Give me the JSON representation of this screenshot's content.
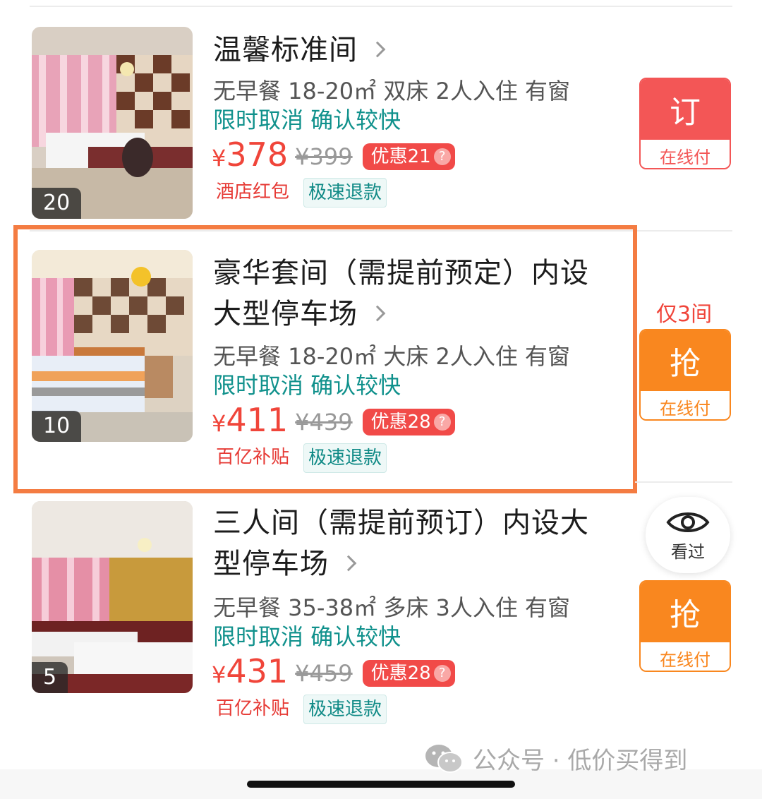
{
  "rooms": [
    {
      "title": "温馨标准间",
      "photo_count": "20",
      "meta": "无早餐 18-20㎡ 双床 2人入住 有窗",
      "policy": "限时取消 确认较快",
      "price_symbol": "¥",
      "price": "378",
      "original_price": "¥399",
      "discount": "优惠21",
      "tags": [
        "酒店红包",
        "极速退款"
      ],
      "availability": "",
      "button_main": "订",
      "button_sub": "在线付",
      "button_color": "#f35656"
    },
    {
      "title": "豪华套间（需提前预定）内设大型停车场",
      "photo_count": "10",
      "meta": "无早餐 18-20㎡ 大床 2人入住 有窗",
      "policy": "限时取消 确认较快",
      "price_symbol": "¥",
      "price": "411",
      "original_price": "¥439",
      "discount": "优惠28",
      "tags": [
        "百亿补贴",
        "极速退款"
      ],
      "availability": "仅3间",
      "button_main": "抢",
      "button_sub": "在线付",
      "button_color": "#f9871f"
    },
    {
      "title": "三人间（需提前预订）内设大型停车场",
      "photo_count": "5",
      "meta": "无早餐 35-38㎡ 多床 3人入住 有窗",
      "policy": "限时取消 确认较快",
      "price_symbol": "¥",
      "price": "431",
      "original_price": "¥459",
      "discount": "优惠28",
      "tags": [
        "百亿补贴",
        "极速退款"
      ],
      "availability": "",
      "button_main": "抢",
      "button_sub": "在线付",
      "button_color": "#f9871f"
    }
  ],
  "discount_help": "?",
  "viewed_button": {
    "label": "看过",
    "icon": "eye-icon"
  },
  "watermark": {
    "icon": "wechat-icon",
    "text": "公众号 · 低价买得到"
  },
  "colors": {
    "price_red": "#f0453a",
    "policy_teal": "#10918c",
    "highlight_orange": "#f47c42"
  }
}
